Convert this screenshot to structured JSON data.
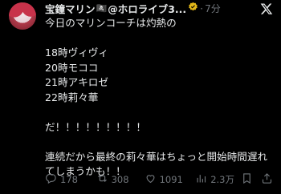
{
  "post": {
    "author_name": "宝鐘マリン",
    "author_badge": "🏴‍☠️",
    "handle": "@ホロライブ3...",
    "dot": "·",
    "time": "7分",
    "lines": [
      "今日のマリンコーチは灼熱の",
      "",
      "18時ヴィヴィ",
      "20時モココ",
      "21時アキロゼ",
      "22時莉々華",
      "",
      "だ！！！！！！！！！",
      "",
      "連続だから最終の莉々華はちょっと開始時間遅れ",
      "てしまうかも！！"
    ]
  },
  "actions": {
    "reply_count": "178",
    "repost_count": "308",
    "like_count": "1091",
    "views_count": "2.3万"
  },
  "colors": {
    "background": "#000000",
    "text": "#e7e9ea",
    "muted": "#71767b",
    "verified": "#e2b719"
  },
  "icons": [
    "avatar",
    "verified-badge-icon",
    "x-logo-icon",
    "reply-icon",
    "repost-icon",
    "like-icon",
    "views-icon",
    "bookmark-icon",
    "share-icon"
  ]
}
